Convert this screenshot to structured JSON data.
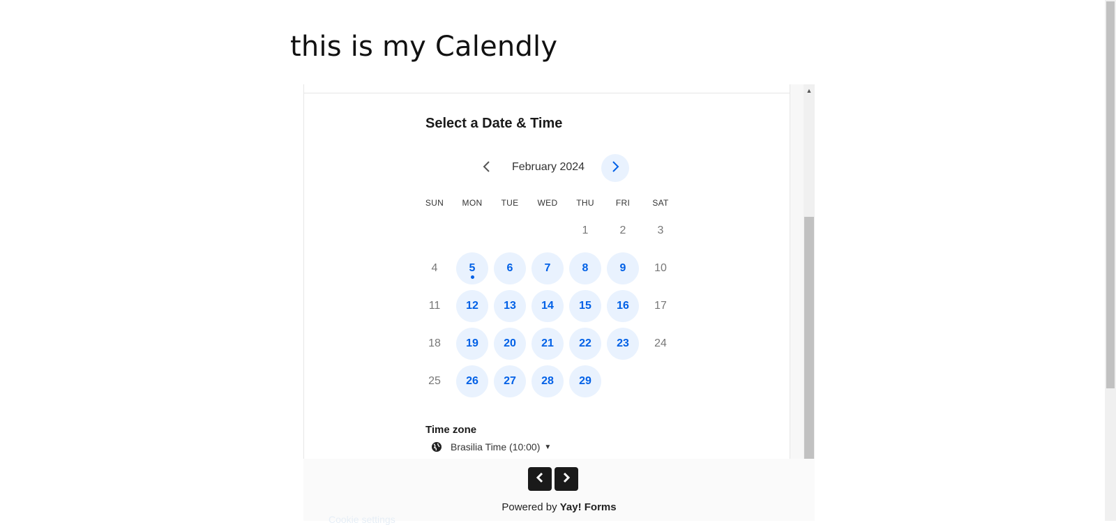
{
  "page": {
    "title": "this is my Calendly"
  },
  "scheduler": {
    "heading": "Select a Date & Time",
    "month_label": "February 2024",
    "weekdays": [
      "SUN",
      "MON",
      "TUE",
      "WED",
      "THU",
      "FRI",
      "SAT"
    ],
    "days": [
      {
        "n": "1",
        "col": 4,
        "row": 0,
        "avail": false
      },
      {
        "n": "2",
        "col": 5,
        "row": 0,
        "avail": false
      },
      {
        "n": "3",
        "col": 6,
        "row": 0,
        "avail": false
      },
      {
        "n": "4",
        "col": 0,
        "row": 1,
        "avail": false
      },
      {
        "n": "5",
        "col": 1,
        "row": 1,
        "avail": true,
        "today": true
      },
      {
        "n": "6",
        "col": 2,
        "row": 1,
        "avail": true
      },
      {
        "n": "7",
        "col": 3,
        "row": 1,
        "avail": true
      },
      {
        "n": "8",
        "col": 4,
        "row": 1,
        "avail": true
      },
      {
        "n": "9",
        "col": 5,
        "row": 1,
        "avail": true
      },
      {
        "n": "10",
        "col": 6,
        "row": 1,
        "avail": false
      },
      {
        "n": "11",
        "col": 0,
        "row": 2,
        "avail": false
      },
      {
        "n": "12",
        "col": 1,
        "row": 2,
        "avail": true
      },
      {
        "n": "13",
        "col": 2,
        "row": 2,
        "avail": true
      },
      {
        "n": "14",
        "col": 3,
        "row": 2,
        "avail": true
      },
      {
        "n": "15",
        "col": 4,
        "row": 2,
        "avail": true
      },
      {
        "n": "16",
        "col": 5,
        "row": 2,
        "avail": true
      },
      {
        "n": "17",
        "col": 6,
        "row": 2,
        "avail": false
      },
      {
        "n": "18",
        "col": 0,
        "row": 3,
        "avail": false
      },
      {
        "n": "19",
        "col": 1,
        "row": 3,
        "avail": true
      },
      {
        "n": "20",
        "col": 2,
        "row": 3,
        "avail": true
      },
      {
        "n": "21",
        "col": 3,
        "row": 3,
        "avail": true
      },
      {
        "n": "22",
        "col": 4,
        "row": 3,
        "avail": true
      },
      {
        "n": "23",
        "col": 5,
        "row": 3,
        "avail": true
      },
      {
        "n": "24",
        "col": 6,
        "row": 3,
        "avail": false
      },
      {
        "n": "25",
        "col": 0,
        "row": 4,
        "avail": false
      },
      {
        "n": "26",
        "col": 1,
        "row": 4,
        "avail": true
      },
      {
        "n": "27",
        "col": 2,
        "row": 4,
        "avail": true
      },
      {
        "n": "28",
        "col": 3,
        "row": 4,
        "avail": true
      },
      {
        "n": "29",
        "col": 4,
        "row": 4,
        "avail": true
      }
    ],
    "timezone_label": "Time zone",
    "timezone_value": "Brasilia Time (10:00)"
  },
  "footer": {
    "powered_prefix": "Powered by",
    "powered_brand": "Yay! Forms",
    "cookie_settings": "Cookie settings"
  },
  "icons": {
    "prev_month": "chevron-left-icon",
    "next_month": "chevron-right-icon",
    "globe": "globe-icon",
    "caret": "caret-down-icon"
  },
  "colors": {
    "accent": "#0060e6",
    "accent_bg": "#e9f2fe"
  }
}
